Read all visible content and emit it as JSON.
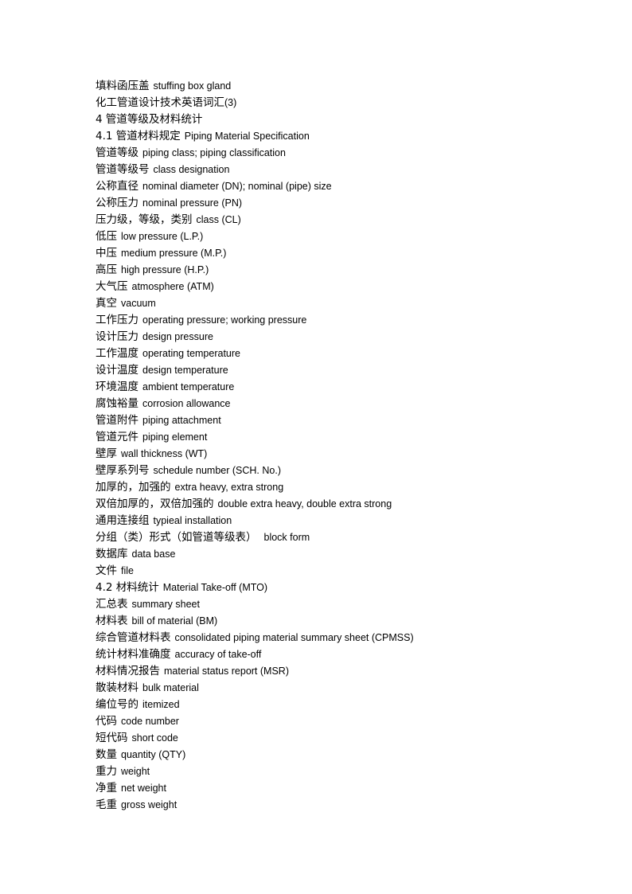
{
  "document": {
    "page_background": "#ffffff",
    "text_color": "#000000",
    "lines": [
      {
        "zh": "填料函压盖",
        "en": "stuffing box gland"
      },
      {
        "zh": "化工管道设计技术英语词汇",
        "en": "(3)",
        "no_gap": true
      },
      {
        "zh": "4 管道等级及材料统计",
        "en": ""
      },
      {
        "zh": "4.1 管道材料规定",
        "en": "Piping Material Specification"
      },
      {
        "zh": "管道等级",
        "en": "piping class; piping classification"
      },
      {
        "zh": "管道等级号",
        "en": "class designation"
      },
      {
        "zh": "公称直径",
        "en": "nominal diameter (DN); nominal (pipe) size"
      },
      {
        "zh": "公称压力",
        "en": "nominal pressure (PN)"
      },
      {
        "zh": "压力级，等级，类别",
        "en": "class (CL)"
      },
      {
        "zh": "低压",
        "en": "low pressure (L.P.)"
      },
      {
        "zh": "中压",
        "en": "medium pressure (M.P.)"
      },
      {
        "zh": "高压",
        "en": "high pressure (H.P.)"
      },
      {
        "zh": "大气压",
        "en": "atmosphere (ATM)"
      },
      {
        "zh": "真空",
        "en": "vacuum"
      },
      {
        "zh": "工作压力",
        "en": "operating pressure; working pressure"
      },
      {
        "zh": "设计压力",
        "en": "design pressure"
      },
      {
        "zh": "工作温度",
        "en": "operating temperature"
      },
      {
        "zh": "设计温度",
        "en": "design temperature"
      },
      {
        "zh": "环境温度",
        "en": "ambient temperature"
      },
      {
        "zh": "腐蚀裕量",
        "en": "corrosion allowance"
      },
      {
        "zh": "管道附件",
        "en": "piping attachment"
      },
      {
        "zh": "管道元件",
        "en": "piping element"
      },
      {
        "zh": "壁厚",
        "en": "wall thickness (WT)"
      },
      {
        "zh": "壁厚系列号",
        "en": "schedule number (SCH. No.)"
      },
      {
        "zh": "加厚的，加强的",
        "en": "extra heavy, extra strong"
      },
      {
        "zh": "双倍加厚的，双倍加强的",
        "en": "double extra heavy, double extra strong"
      },
      {
        "zh": "通用连接组",
        "en": "typieal installation"
      },
      {
        "zh": "分组（类）形式（如管道等级表）",
        "en": "block form",
        "wide_gap": true
      },
      {
        "zh": "数据库",
        "en": "data base"
      },
      {
        "zh": "文件",
        "en": "file"
      },
      {
        "zh": "4.2 材料统计",
        "en": "Material Take-off (MTO)"
      },
      {
        "zh": "汇总表",
        "en": "summary sheet"
      },
      {
        "zh": "材料表",
        "en": "bill of material (BM)"
      },
      {
        "zh": "综合管道材料表",
        "en": "consolidated piping material summary sheet (CPMSS)"
      },
      {
        "zh": "统计材料准确度",
        "en": "accuracy of take-off"
      },
      {
        "zh": "材料情况报告",
        "en": "material status report (MSR)"
      },
      {
        "zh": "散装材料",
        "en": "bulk material"
      },
      {
        "zh": "编位号的",
        "en": "itemized"
      },
      {
        "zh": "代码",
        "en": "code number"
      },
      {
        "zh": "短代码",
        "en": "short code"
      },
      {
        "zh": "数量",
        "en": "quantity (QTY)"
      },
      {
        "zh": "重力",
        "en": "weight"
      },
      {
        "zh": "净重",
        "en": "net weight"
      },
      {
        "zh": "毛重",
        "en": "gross weight"
      }
    ]
  }
}
